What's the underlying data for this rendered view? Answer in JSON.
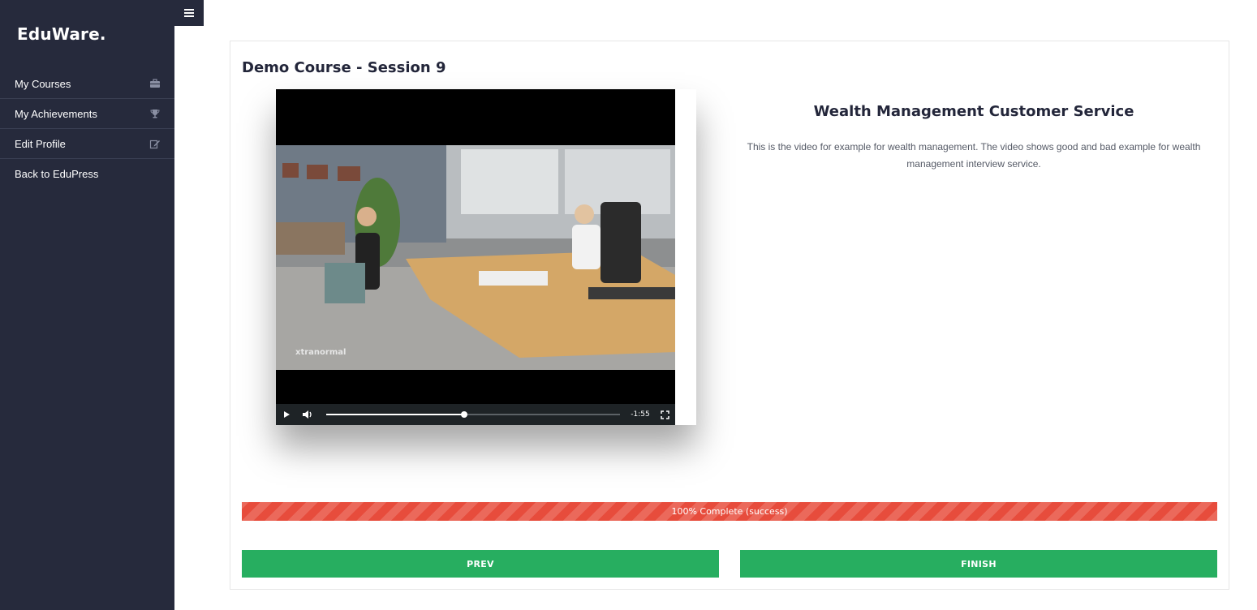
{
  "brand": "EduWare.",
  "sidebar": {
    "items": [
      {
        "label": "My Courses",
        "icon": "briefcase-icon"
      },
      {
        "label": "My Achievements",
        "icon": "trophy-icon"
      },
      {
        "label": "Edit Profile",
        "icon": "edit-icon"
      },
      {
        "label": "Back to EduPress",
        "icon": ""
      }
    ]
  },
  "course": {
    "title": "Demo Course - Session 9"
  },
  "video": {
    "title": "Wealth Management Customer Service",
    "description": "This is the video for example for wealth management. The video shows good and bad example for wealth management interview service.",
    "watermark": "xtranormal",
    "time_remaining": "-1:55",
    "progress_fraction": 0.47
  },
  "progress": {
    "label": "100% Complete (success)",
    "percent": 100,
    "color": "#e74c3c"
  },
  "buttons": {
    "prev": "PREV",
    "finish": "FINISH"
  },
  "colors": {
    "sidebar": "#262a3c",
    "accent_green": "#27ae60",
    "progress_red": "#e74c3c"
  }
}
